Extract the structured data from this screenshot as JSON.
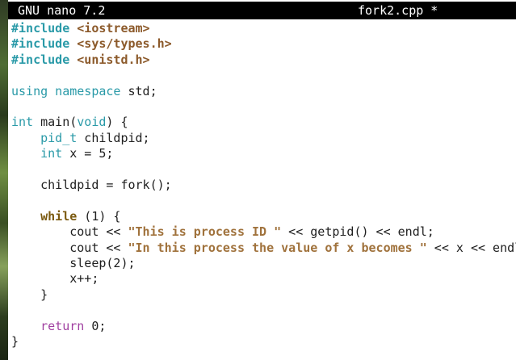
{
  "titlebar": {
    "app": "GNU nano 7.2",
    "file": "fork2.cpp *"
  },
  "editor": {
    "lines": [
      [
        {
          "cls": "kw-pre",
          "text": "#include"
        },
        {
          "cls": "plain",
          "text": " "
        },
        {
          "cls": "kw-inc",
          "text": "<iostream>"
        }
      ],
      [
        {
          "cls": "kw-pre",
          "text": "#include"
        },
        {
          "cls": "plain",
          "text": " "
        },
        {
          "cls": "kw-inc",
          "text": "<sys/types.h>"
        }
      ],
      [
        {
          "cls": "kw-pre",
          "text": "#include"
        },
        {
          "cls": "plain",
          "text": " "
        },
        {
          "cls": "kw-inc",
          "text": "<unistd.h>"
        }
      ],
      [],
      [
        {
          "cls": "kw-type",
          "text": "using namespace"
        },
        {
          "cls": "plain",
          "text": " std;"
        }
      ],
      [],
      [
        {
          "cls": "kw-type",
          "text": "int"
        },
        {
          "cls": "plain",
          "text": " main("
        },
        {
          "cls": "kw-type",
          "text": "void"
        },
        {
          "cls": "plain",
          "text": ") {"
        }
      ],
      [
        {
          "cls": "plain",
          "text": "    "
        },
        {
          "cls": "kw-type",
          "text": "pid_t"
        },
        {
          "cls": "plain",
          "text": " childpid;"
        }
      ],
      [
        {
          "cls": "plain",
          "text": "    "
        },
        {
          "cls": "kw-type",
          "text": "int"
        },
        {
          "cls": "plain",
          "text": " x = 5;"
        }
      ],
      [],
      [
        {
          "cls": "plain",
          "text": "    childpid = fork();"
        }
      ],
      [],
      [
        {
          "cls": "plain",
          "text": "    "
        },
        {
          "cls": "kw-while",
          "text": "while"
        },
        {
          "cls": "plain",
          "text": " (1) {"
        }
      ],
      [
        {
          "cls": "plain",
          "text": "        cout << "
        },
        {
          "cls": "str",
          "text": "\"This is process ID \""
        },
        {
          "cls": "plain",
          "text": " << getpid() << endl;"
        }
      ],
      [
        {
          "cls": "plain",
          "text": "        cout << "
        },
        {
          "cls": "str",
          "text": "\"In this process the value of x becomes \""
        },
        {
          "cls": "plain",
          "text": " << x << endl;"
        }
      ],
      [
        {
          "cls": "plain",
          "text": "        sleep(2);"
        }
      ],
      [
        {
          "cls": "plain",
          "text": "        x++;"
        }
      ],
      [
        {
          "cls": "plain",
          "text": "    }"
        }
      ],
      [],
      [
        {
          "cls": "plain",
          "text": "    "
        },
        {
          "cls": "kw-return",
          "text": "return"
        },
        {
          "cls": "plain",
          "text": " 0;"
        }
      ],
      [
        {
          "cls": "plain",
          "text": "}"
        }
      ]
    ]
  }
}
